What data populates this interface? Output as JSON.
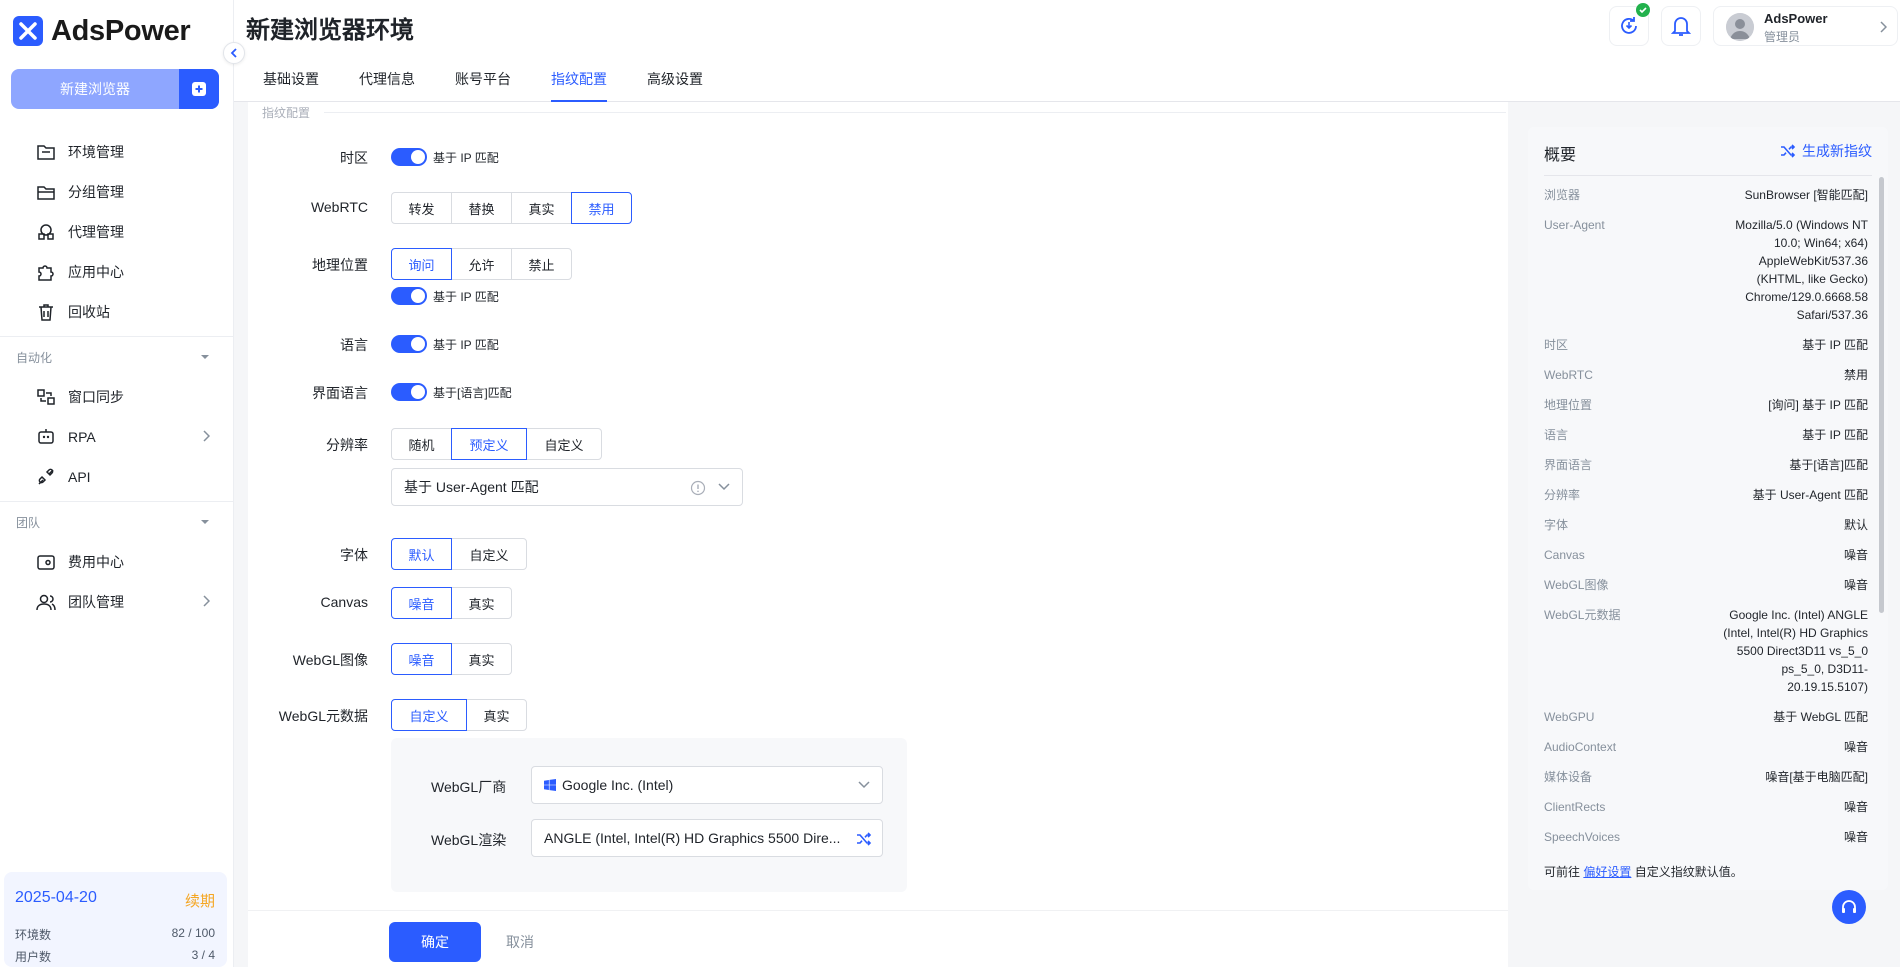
{
  "app": {
    "name": "AdsPower"
  },
  "sidebar": {
    "new_browser_label": "新建浏览器",
    "items": [
      {
        "label": "环境管理",
        "icon": "folder-icon"
      },
      {
        "label": "分组管理",
        "icon": "folder-open-icon"
      },
      {
        "label": "代理管理",
        "icon": "proxy-icon"
      },
      {
        "label": "应用中心",
        "icon": "puzzle-icon"
      },
      {
        "label": "回收站",
        "icon": "trash-icon"
      }
    ],
    "automation_title": "自动化",
    "automation_items": [
      {
        "label": "窗口同步",
        "icon": "sync-window-icon"
      },
      {
        "label": "RPA",
        "icon": "robot-icon"
      },
      {
        "label": "API",
        "icon": "api-icon"
      }
    ],
    "team_title": "团队",
    "team_items": [
      {
        "label": "费用中心",
        "icon": "wallet-icon"
      },
      {
        "label": "团队管理",
        "icon": "users-icon"
      }
    ],
    "subscription": {
      "date": "2025-04-20",
      "renew": "续期",
      "env_label": "环境数",
      "env_value": "82 / 100",
      "user_label": "用户数",
      "user_value": "3 / 4"
    }
  },
  "header": {
    "title": "新建浏览器环境",
    "user_name": "AdsPower",
    "user_role": "管理员"
  },
  "tabs": [
    {
      "label": "基础设置",
      "active": false
    },
    {
      "label": "代理信息",
      "active": false
    },
    {
      "label": "账号平台",
      "active": false
    },
    {
      "label": "指纹配置",
      "active": true
    },
    {
      "label": "高级设置",
      "active": false
    }
  ],
  "form": {
    "section_label": "指纹配置",
    "timezone": {
      "label": "时区",
      "toggle_text": "基于 IP 匹配"
    },
    "webrtc": {
      "label": "WebRTC",
      "options": [
        "转发",
        "替换",
        "真实",
        "禁用"
      ],
      "selected": "禁用"
    },
    "geo": {
      "label": "地理位置",
      "options": [
        "询问",
        "允许",
        "禁止"
      ],
      "selected": "询问",
      "toggle_text": "基于 IP 匹配"
    },
    "language": {
      "label": "语言",
      "toggle_text": "基于 IP 匹配"
    },
    "ui_language": {
      "label": "界面语言",
      "toggle_text": "基于[语言]匹配"
    },
    "resolution": {
      "label": "分辨率",
      "options": [
        "随机",
        "预定义",
        "自定义"
      ],
      "selected": "预定义",
      "select_value": "基于 User-Agent 匹配"
    },
    "font": {
      "label": "字体",
      "options": [
        "默认",
        "自定义"
      ],
      "selected": "默认"
    },
    "canvas": {
      "label": "Canvas",
      "options": [
        "噪音",
        "真实"
      ],
      "selected": "噪音"
    },
    "webgl_image": {
      "label": "WebGL图像",
      "options": [
        "噪音",
        "真实"
      ],
      "selected": "噪音"
    },
    "webgl_meta": {
      "label": "WebGL元数据",
      "options": [
        "自定义",
        "真实"
      ],
      "selected": "自定义",
      "vendor_label": "WebGL厂商",
      "vendor_value": "Google Inc. (Intel)",
      "renderer_label": "WebGL渲染",
      "renderer_value": "ANGLE (Intel, Intel(R) HD Graphics 5500 Dire..."
    },
    "confirm_label": "确定",
    "cancel_label": "取消"
  },
  "summary": {
    "title": "概要",
    "generate_label": "生成新指纹",
    "rows": [
      {
        "k": "浏览器",
        "v": "SunBrowser [智能匹配]"
      },
      {
        "k": "User-Agent",
        "v": "Mozilla/5.0 (Windows NT 10.0; Win64; x64) AppleWebKit/537.36 (KHTML, like Gecko) Chrome/129.0.6668.58 Safari/537.36"
      },
      {
        "k": "时区",
        "v": "基于 IP 匹配"
      },
      {
        "k": "WebRTC",
        "v": "禁用"
      },
      {
        "k": "地理位置",
        "v": "[询问] 基于 IP 匹配"
      },
      {
        "k": "语言",
        "v": "基于 IP 匹配"
      },
      {
        "k": "界面语言",
        "v": "基于[语言]匹配"
      },
      {
        "k": "分辨率",
        "v": "基于 User-Agent 匹配"
      },
      {
        "k": "字体",
        "v": "默认"
      },
      {
        "k": "Canvas",
        "v": "噪音"
      },
      {
        "k": "WebGL图像",
        "v": "噪音"
      },
      {
        "k": "WebGL元数据",
        "v": "Google Inc. (Intel) ANGLE (Intel, Intel(R) HD Graphics 5500 Direct3D11 vs_5_0 ps_5_0, D3D11-20.19.15.5107)"
      },
      {
        "k": "WebGPU",
        "v": "基于 WebGL 匹配"
      },
      {
        "k": "AudioContext",
        "v": "噪音"
      },
      {
        "k": "媒体设备",
        "v": "噪音[基于电脑匹配]"
      },
      {
        "k": "ClientRects",
        "v": "噪音"
      },
      {
        "k": "SpeechVoices",
        "v": "噪音"
      }
    ],
    "footer_prefix": "可前往",
    "footer_link": "偏好设置",
    "footer_suffix": "自定义指纹默认值。"
  },
  "colors": {
    "accent": "#2b5cff",
    "accent_light": "#8ea6ff",
    "renew": "#f5a623",
    "update_badge": "#22b14c"
  }
}
